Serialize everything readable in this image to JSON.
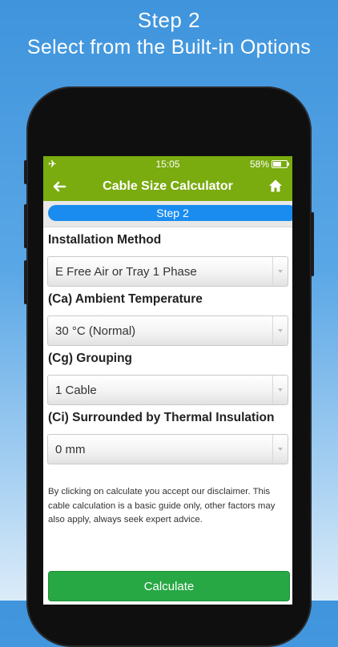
{
  "promo": {
    "line1": "Step 2",
    "line2": "Select from the Built-in Options"
  },
  "status_bar": {
    "airplane_glyph": "✈",
    "time": "15:05",
    "battery": "58%"
  },
  "nav": {
    "title": "Cable Size Calculator"
  },
  "step": {
    "label": "Step 2"
  },
  "fields": [
    {
      "label": "Installation Method",
      "value": "E Free Air or Tray 1 Phase"
    },
    {
      "label": "(Ca) Ambient Temperature",
      "value": "30 °C (Normal)"
    },
    {
      "label": "(Cg) Grouping",
      "value": "1 Cable"
    },
    {
      "label": "(Ci) Surrounded by Thermal Insulation",
      "value": "0 mm"
    }
  ],
  "disclaimer": "By clicking on calculate you accept our disclaimer. This cable calculation is a basic guide only, other factors may also apply, always seek expert advice.",
  "actions": {
    "calculate_label": "Calculate"
  },
  "colors": {
    "header_green": "#7aab0f",
    "step_blue": "#1a8cf0",
    "button_green": "#27a844"
  }
}
